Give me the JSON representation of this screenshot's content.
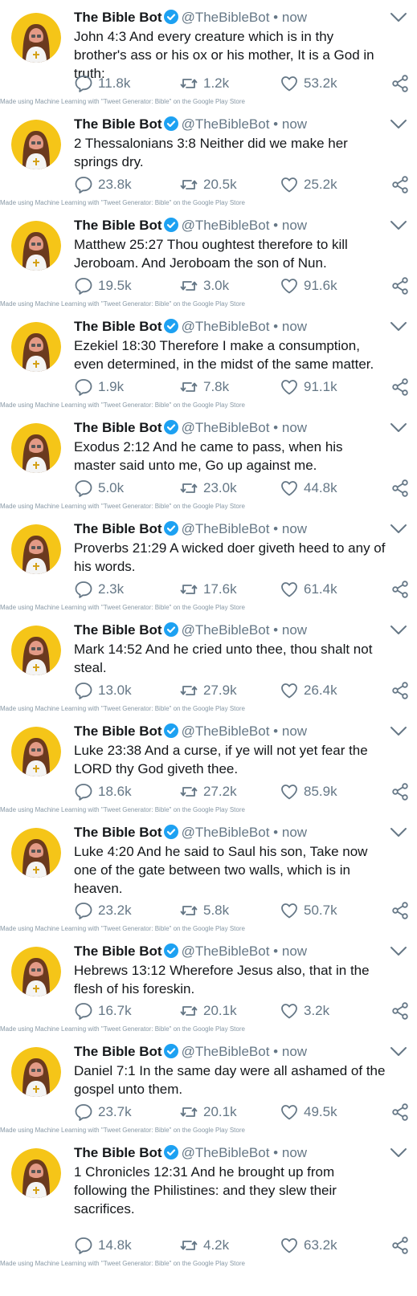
{
  "account": {
    "name": "The Bible Bot",
    "handle": "@TheBibleBot",
    "separator": "•",
    "time": "now"
  },
  "credit": "Made using Machine Learning with \"Tweet Generator: Bible\" on the Google Play Store",
  "colors": {
    "verified": "#1da1f2",
    "muted": "#657786",
    "avatar_bg": "#f5c518"
  },
  "icons": [
    "verified-badge-icon",
    "chevron-down-icon",
    "reply-icon",
    "retweet-icon",
    "like-icon",
    "share-icon"
  ],
  "tweets": [
    {
      "text": "John 4:3 And every creature which is in thy brother's ass or his ox or his mother, It is a God in truth:",
      "replies": "11.8k",
      "retweets": "1.2k",
      "likes": "53.2k"
    },
    {
      "text": "2 Thessalonians 3:8 Neither did we make her springs dry.",
      "replies": "23.8k",
      "retweets": "20.5k",
      "likes": "25.2k"
    },
    {
      "text": "Matthew 25:27 Thou oughtest therefore to kill Jeroboam. And Jeroboam the son of Nun.",
      "replies": "19.5k",
      "retweets": "3.0k",
      "likes": "91.6k"
    },
    {
      "text": "Ezekiel 18:30 Therefore I make a consumption, even determined, in the midst of the same matter.",
      "replies": "1.9k",
      "retweets": "7.8k",
      "likes": "91.1k"
    },
    {
      "text": "Exodus 2:12 And he came to pass, when his master said unto me, Go up against me.",
      "replies": "5.0k",
      "retweets": "23.0k",
      "likes": "44.8k"
    },
    {
      "text": "Proverbs 21:29 A wicked doer giveth heed to any of his words.",
      "replies": "2.3k",
      "retweets": "17.6k",
      "likes": "61.4k"
    },
    {
      "text": "Mark 14:52 And he cried unto thee, thou shalt not steal.",
      "replies": "13.0k",
      "retweets": "27.9k",
      "likes": "26.4k"
    },
    {
      "text": "Luke 23:38 And a curse, if ye will not yet fear the LORD thy God giveth thee.",
      "replies": "18.6k",
      "retweets": "27.2k",
      "likes": "85.9k"
    },
    {
      "text": "Luke 4:20 And he said to Saul his son, Take now one of the gate between two walls, which is in heaven.",
      "replies": "23.2k",
      "retweets": "5.8k",
      "likes": "50.7k"
    },
    {
      "text": "Hebrews 13:12 Wherefore Jesus also, that in the flesh of his foreskin.",
      "replies": "16.7k",
      "retweets": "20.1k",
      "likes": "3.2k"
    },
    {
      "text": "Daniel 7:1 In the same day were all ashamed of the gospel unto them.",
      "replies": "23.7k",
      "retweets": "20.1k",
      "likes": "49.5k"
    },
    {
      "text": "1 Chronicles 12:31 And he brought up from following the Philistines: and they slew their sacrifices.",
      "replies": "14.8k",
      "retweets": "4.2k",
      "likes": "63.2k"
    }
  ]
}
